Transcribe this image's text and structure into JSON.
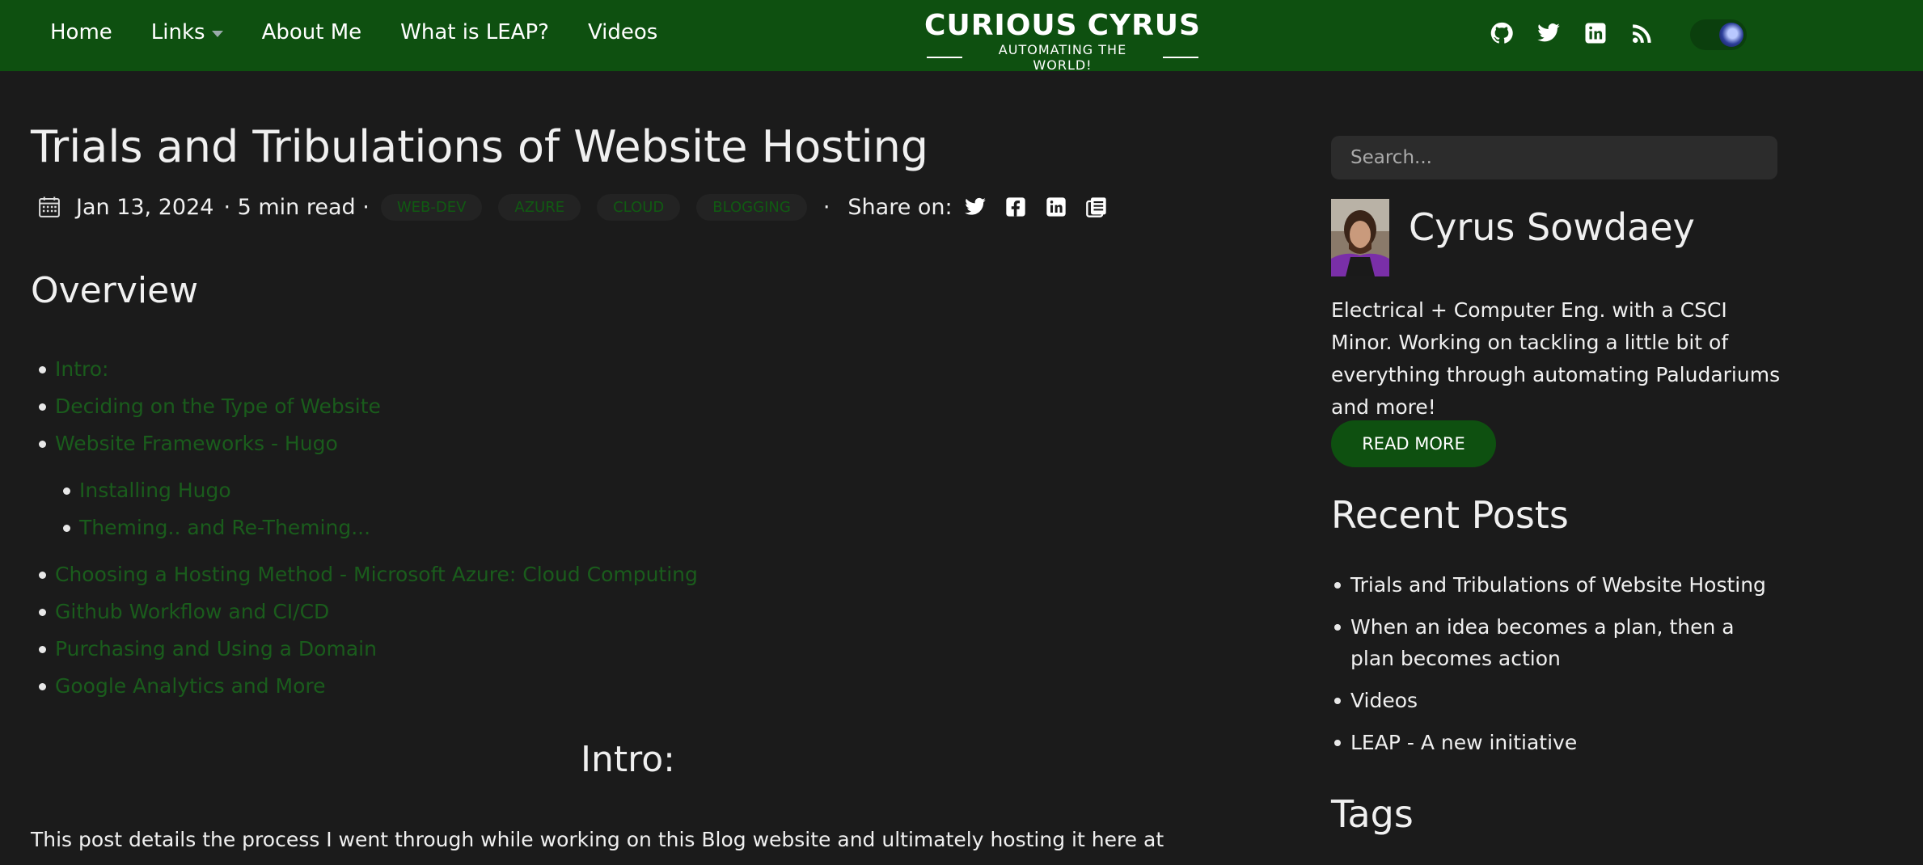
{
  "nav": {
    "links": [
      "Home",
      "Links",
      "About Me",
      "What is LEAP?",
      "Videos"
    ],
    "logo_main_left": "CURIOUS",
    "logo_main_right": "CYRUS",
    "logo_tagline": "AUTOMATING THE WORLD!",
    "social_icons": [
      "github-icon",
      "twitter-icon",
      "linkedin-icon",
      "rss-icon"
    ],
    "theme_toggle": "dark-mode-toggle"
  },
  "post": {
    "title": "Trials and Tribulations of Website Hosting",
    "date": "Jan 13, 2024",
    "read_time": "· 5 min read ·",
    "tags": [
      "WEB-DEV",
      "AZURE",
      "CLOUD",
      "BLOGGING"
    ],
    "share_sep": "·",
    "share_label": "Share on:",
    "share_icons": [
      "twitter-icon",
      "facebook-icon",
      "linkedin-icon",
      "copy-icon"
    ],
    "overview_heading": "Overview",
    "toc": [
      "Intro:",
      "Deciding on the Type of Website",
      "Website Frameworks - Hugo",
      "Installing Hugo",
      "Theming.. and Re-Theming...",
      "Choosing a Hosting Method - Microsoft Azure: Cloud Computing",
      "Github Workflow and CI/CD",
      "Purchasing and Using a Domain",
      "Google Analytics and More"
    ],
    "intro_heading": "Intro:",
    "intro_text": "This post details the process I went through while working on this Blog website and ultimately hosting it here at"
  },
  "sidebar": {
    "search_placeholder": "Search...",
    "author_name": "Cyrus Sowdaey",
    "bio": "Electrical + Computer Eng. with a CSCI Minor. Working on tackling a little bit of everything through automating Paludariums and more!",
    "read_more": "READ MORE",
    "recent_heading": "Recent Posts",
    "recent_posts": [
      "Trials and Tribulations of Website Hosting",
      "When an idea becomes a plan, then a plan becomes action",
      "Videos",
      "LEAP - A new initiative"
    ],
    "tags_heading": "Tags"
  },
  "colors": {
    "nav_bg": "#0e5010",
    "page_bg": "#1b1b1b",
    "link_green": "#1a5c1c",
    "button_green": "#0e5010"
  }
}
